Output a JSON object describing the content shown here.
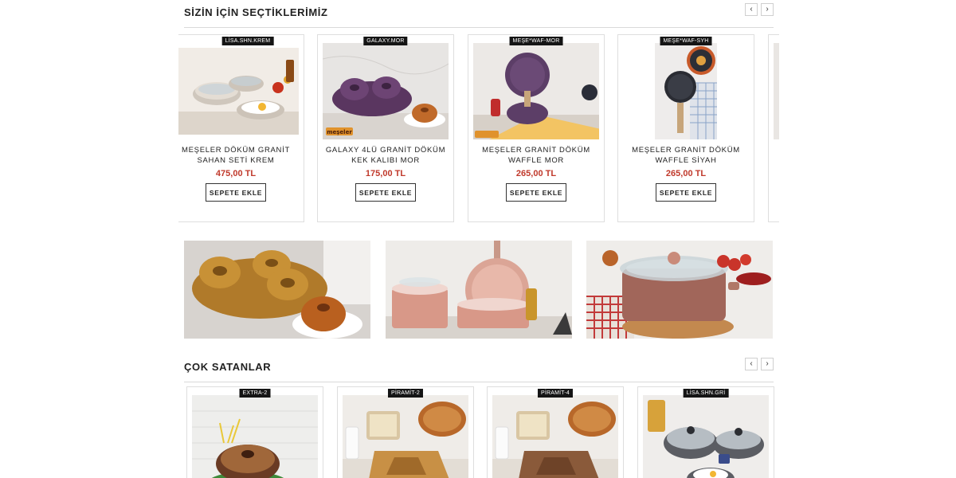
{
  "section1": {
    "title": "SİZİN İÇİN SEÇTİKLERİMİZ",
    "prev": "‹",
    "next": "›",
    "products": [
      {
        "sku": "LİSA.SHN.KREM",
        "name_line1": "MEŞELER DÖKÜM GRANİT",
        "name_line2": "SAHAN SETİ KREM",
        "price": "475,00 TL",
        "button": "SEPETE EKLE"
      },
      {
        "sku": "GALAXY.MOR",
        "name_line1": "GALAXY 4LÜ GRANİT DÖKÜM",
        "name_line2": "KEK KALIBI MOR",
        "price": "175,00 TL",
        "button": "SEPETE EKLE"
      },
      {
        "sku": "MEŞE*WAF-MOR",
        "name_line1": "MEŞELER GRANİT DÖKÜM",
        "name_line2": "WAFFLE MOR",
        "price": "265,00 TL",
        "button": "SEPETE EKLE"
      },
      {
        "sku": "MEŞE*WAF-SYH",
        "name_line1": "MEŞELER GRANİT DÖKÜM",
        "name_line2": "WAFFLE SİYAH",
        "price": "265,00 TL",
        "button": "SEPETE EKLE"
      }
    ]
  },
  "section2": {
    "title": "ÇOK SATANLAR",
    "prev": "‹",
    "next": "›",
    "products": [
      {
        "sku": "EXTRA-2"
      },
      {
        "sku": "PİRAMİT-2"
      },
      {
        "sku": "PİRAMİT-4"
      },
      {
        "sku": "LİSA.SHN.GRİ"
      }
    ]
  },
  "brand_text": "meşeler",
  "colors": {
    "price": "#c0392b",
    "accent_dark": "#151515",
    "border": "#dedede"
  }
}
